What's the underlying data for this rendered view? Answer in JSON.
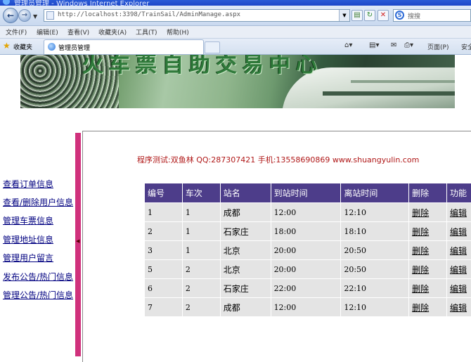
{
  "window": {
    "title": "管理员管理 - Windows Internet Explorer"
  },
  "address": {
    "url": "http://localhost:3398/TrainSail/AdminManage.aspx"
  },
  "search": {
    "placeholder": "搜搜"
  },
  "menu": [
    "文件(F)",
    "编辑(E)",
    "查看(V)",
    "收藏夹(A)",
    "工具(T)",
    "帮助(H)"
  ],
  "favorites": {
    "label": "收藏夹"
  },
  "tab": {
    "label": "管理员管理"
  },
  "toolbar": {
    "page": "页面(P)",
    "safety": "安全"
  },
  "banner": {
    "title": "火车票自助交易中心"
  },
  "sidebar": {
    "links": [
      "查看订单信息",
      "查看/删除用户信息",
      "管理车票信息",
      "管理地址信息",
      "管理用户留言",
      "发布公告/热门信息",
      "管理公告/热门信息"
    ]
  },
  "credit": "程序测试:双鱼林 QQ:287307421 手机:13558690869 www.shuangyulin.com",
  "table": {
    "headers": [
      "编号",
      "车次",
      "站名",
      "到站时间",
      "离站时间",
      "删除",
      "功能"
    ],
    "rows": [
      [
        "1",
        "1",
        "成都",
        "12:00",
        "12:10",
        "删除",
        "编辑"
      ],
      [
        "2",
        "1",
        "石家庄",
        "18:00",
        "18:10",
        "删除",
        "编辑"
      ],
      [
        "3",
        "1",
        "北京",
        "20:00",
        "20:50",
        "删除",
        "编辑"
      ],
      [
        "5",
        "2",
        "北京",
        "20:00",
        "20:50",
        "删除",
        "编辑"
      ],
      [
        "6",
        "2",
        "石家庄",
        "22:00",
        "22:10",
        "删除",
        "编辑"
      ],
      [
        "7",
        "2",
        "成都",
        "12:00",
        "12:10",
        "删除",
        "编辑"
      ]
    ]
  },
  "colors": {
    "header_bg": "#4d3d8a",
    "row_bg": "#e4e4e4",
    "accent_bar": "#d0317c",
    "credit": "#b01818"
  }
}
